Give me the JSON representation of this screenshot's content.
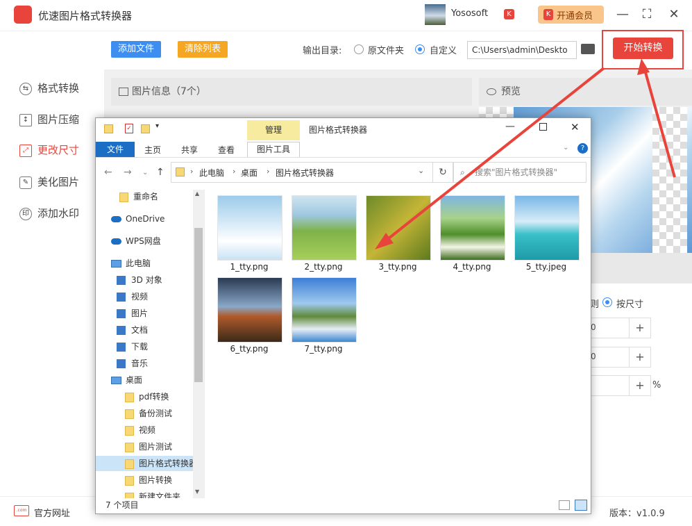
{
  "app": {
    "title": "优速图片格式转换器",
    "user": "Yososoft",
    "vip_label": "开通会员",
    "k_badge": "K"
  },
  "sidebar": {
    "items": [
      {
        "label": "格式转换",
        "icon": "format-icon",
        "active": false
      },
      {
        "label": "图片压缩",
        "icon": "compress-icon",
        "active": false
      },
      {
        "label": "更改尺寸",
        "icon": "resize-icon",
        "active": true
      },
      {
        "label": "美化图片",
        "icon": "beautify-icon",
        "active": false
      },
      {
        "label": "添加水印",
        "icon": "watermark-icon",
        "active": false
      }
    ]
  },
  "toolbar": {
    "add_label": "添加文件",
    "clear_label": "清除列表",
    "output_label": "输出目录:",
    "radio_original": "原文件夹",
    "radio_custom": "自定义",
    "output_path": "C:\\Users\\admin\\Deskto",
    "start_label": "开始转换"
  },
  "panels": {
    "info_title": "图片信息（7个）",
    "preview_title": "预览",
    "by_size_label": "按尺寸",
    "size_partial": "则",
    "field1_value": "0",
    "field2_value": "0",
    "plus": "+",
    "percent": "%"
  },
  "bottom": {
    "site_label": "官方网址",
    "site_icon_text": ".com",
    "version": "版本：v1.0.9"
  },
  "explorer": {
    "title": "图片格式转换器",
    "manage_tab": "管理",
    "ribbon_tabs": [
      "文件",
      "主页",
      "共享",
      "查看",
      "图片工具"
    ],
    "breadcrumb": [
      "此电脑",
      "桌面",
      "图片格式转换器"
    ],
    "search_placeholder": "搜索\"图片格式转换器\"",
    "tree": [
      {
        "label": "重命名",
        "kind": "folder"
      },
      {
        "label": "OneDrive",
        "kind": "cloud"
      },
      {
        "label": "WPS网盘",
        "kind": "cloud"
      },
      {
        "label": "此电脑",
        "kind": "pc"
      },
      {
        "label": "3D 对象",
        "kind": "gen"
      },
      {
        "label": "视频",
        "kind": "gen"
      },
      {
        "label": "图片",
        "kind": "gen"
      },
      {
        "label": "文档",
        "kind": "gen"
      },
      {
        "label": "下载",
        "kind": "gen"
      },
      {
        "label": "音乐",
        "kind": "gen"
      },
      {
        "label": "桌面",
        "kind": "pc"
      },
      {
        "label": "pdf转换",
        "kind": "folder"
      },
      {
        "label": "备份测试",
        "kind": "folder"
      },
      {
        "label": "视频",
        "kind": "folder"
      },
      {
        "label": "图片测试",
        "kind": "folder"
      },
      {
        "label": "图片格式转换器",
        "kind": "folder",
        "selected": true
      },
      {
        "label": "图片转换",
        "kind": "folder"
      },
      {
        "label": "新建文件夹",
        "kind": "folder"
      }
    ],
    "files": [
      {
        "name": "1_tty.png"
      },
      {
        "name": "2_tty.png"
      },
      {
        "name": "3_tty.png"
      },
      {
        "name": "4_tty.png"
      },
      {
        "name": "5_tty.jpeg"
      },
      {
        "name": "6_tty.png"
      },
      {
        "name": "7_tty.png"
      }
    ],
    "status": "7 个项目"
  },
  "colors": {
    "accent_red": "#e8443b",
    "blue": "#3d8ef0",
    "orange": "#f5a623"
  }
}
